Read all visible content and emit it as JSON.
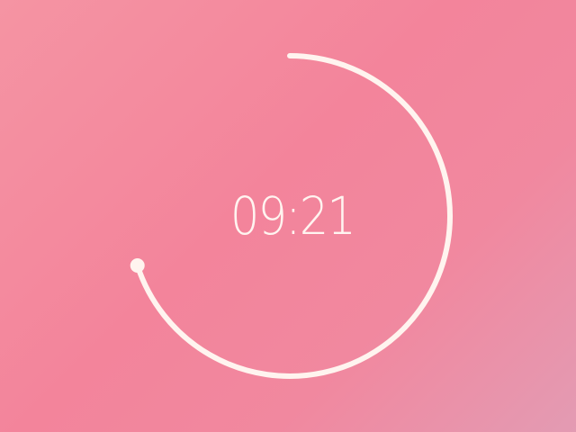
{
  "timer": {
    "time_text": "09:21",
    "progress": 0.7,
    "ring_color": "#fff4ef",
    "background_colors": [
      "#f594a3",
      "#f3849b",
      "#e39bb3"
    ]
  }
}
